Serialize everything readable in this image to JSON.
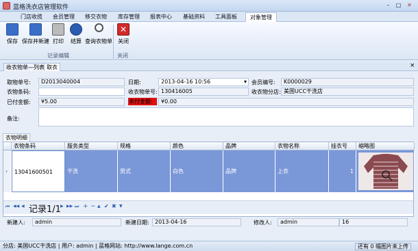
{
  "window": {
    "title": "蓝格洗衣店管理软件",
    "min": "–",
    "max": "□",
    "close": "✕"
  },
  "menu_tabs": [
    "门店收揽",
    "会员管理",
    "移交衣物",
    "库存管理",
    "报表中心",
    "基础资料",
    "工具面板",
    "对象管理"
  ],
  "ribbon": {
    "buttons": [
      {
        "label": "保存",
        "icon": "save-icon",
        "color": "#3a6fc7"
      },
      {
        "label": "保存并新建",
        "icon": "save-new-icon",
        "color": "#3a6fc7"
      },
      {
        "label": "打印",
        "icon": "printer-icon",
        "color": "#666666"
      },
      {
        "label": "结算",
        "icon": "settle-icon",
        "color": "#2a5db0"
      },
      {
        "label": "查询衣物单",
        "icon": "search-icon",
        "color": "#555555"
      },
      {
        "label": "关闭",
        "icon": "close-icon",
        "color": "#d22b2b"
      }
    ],
    "groups": [
      "记录编辑",
      "关闭"
    ]
  },
  "doc_tabs": [
    "收衣物单—列表",
    "取衣"
  ],
  "form": {
    "pickup_no_label": "取物单号:",
    "pickup_no": "D2013040004",
    "date_label": "日期:",
    "date": "2013-04-16 10:56",
    "member_no_label": "会员编号:",
    "member_no": "K0000029",
    "barcode_label": "衣物条码:",
    "barcode": "",
    "receipt_no_label": "收衣物单号:",
    "receipt_no": "130416005",
    "branch_label": "收衣物分店:",
    "branch": "美国UCC干洗店",
    "paid_label": "已付金额:",
    "paid": "¥5.00",
    "unpaid_label": "未付金额:",
    "unpaid": "¥0.00",
    "remark_label": "备注:",
    "remark": ""
  },
  "detail_tab": "衣物明细",
  "grid": {
    "columns": [
      "衣物条码",
      "服务类型",
      "规格",
      "颜色",
      "品牌",
      "衣物名称",
      "挂衣号",
      "缩略图"
    ],
    "rows": [
      {
        "marker": "›",
        "cells": [
          "13041600501",
          "干洗",
          "男式",
          "白色",
          "品牌",
          "上衣",
          "1"
        ]
      }
    ]
  },
  "navbar": {
    "record": "记录1/1",
    "buttons": [
      "⏮",
      "◀◀",
      "◀",
      "▶",
      "▶▶",
      "⏭",
      "+",
      "−",
      "▲",
      "✔",
      "✖",
      "▼"
    ]
  },
  "footer": {
    "creator_label": "新建人:",
    "creator": "admin",
    "create_date_label": "新建日期:",
    "create_date": "2013-04-16",
    "modifier_label": "修改人:",
    "modifier": "admin",
    "extra_value": "16"
  },
  "status": {
    "text": "分店: 美国UCC干洗店 | 用户: admin | 蓝格网站: http://www.lange.com.cn",
    "right": "还有 0 幅图片未上传"
  }
}
